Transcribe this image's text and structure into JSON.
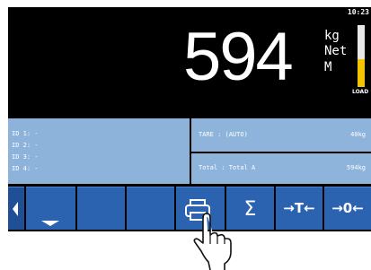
{
  "status": {
    "clock": "10:23"
  },
  "display": {
    "weight": "594",
    "unit": "kg",
    "mode": "Net",
    "motion": "M",
    "load_label": "LOAD",
    "load_level": 0.45
  },
  "ids": [
    "ID 1: -",
    "ID 2: -",
    "ID 3: -",
    "ID 4: -"
  ],
  "tare": {
    "label": "TARE  : (AUTO)",
    "value": "40kg"
  },
  "total": {
    "label": "Total : Total A",
    "value": "594kg"
  },
  "toolbar": {
    "buttons": [
      "left-arrow-icon",
      "down-arrow-icon",
      "blank",
      "blank",
      "printer-icon",
      "sigma-icon",
      "tare-icon",
      "zero-icon"
    ],
    "sum_symbol": "Σ",
    "tare_symbol": "T",
    "zero_symbol": "0"
  },
  "colors": {
    "panel": "#8eb4dc",
    "button": "#2b63b0",
    "load_bar": "#f5c400"
  }
}
